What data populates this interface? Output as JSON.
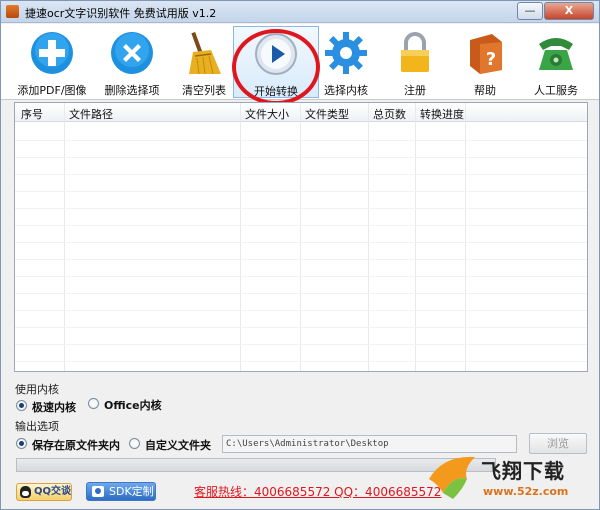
{
  "window": {
    "title": "捷速ocr文字识别软件 免费试用版 v1.2",
    "minimize_glyph": "—",
    "close_glyph": "X"
  },
  "toolbar": {
    "items": [
      {
        "label": "添加PDF/图像",
        "icon": "add-icon"
      },
      {
        "label": "删除选择项",
        "icon": "delete-icon"
      },
      {
        "label": "清空列表",
        "icon": "broom-icon"
      },
      {
        "label": "开始转换",
        "icon": "play-icon"
      },
      {
        "label": "选择内核",
        "icon": "gear-icon"
      },
      {
        "label": "注册",
        "icon": "lock-icon"
      },
      {
        "label": "帮助",
        "icon": "help-book-icon"
      },
      {
        "label": "人工服务",
        "icon": "phone-icon"
      }
    ]
  },
  "file_list": {
    "columns": [
      "序号",
      "文件路径",
      "文件大小",
      "文件类型",
      "总页数",
      "转换进度"
    ],
    "rows": []
  },
  "engine": {
    "section_label": "使用内核",
    "options": [
      {
        "label": "极速内核",
        "checked": true
      },
      {
        "label": "Office内核",
        "checked": false
      }
    ]
  },
  "output": {
    "section_label": "输出选项",
    "options": [
      {
        "label": "保存在原文件夹内",
        "checked": true
      },
      {
        "label": "自定义文件夹",
        "checked": false
      }
    ],
    "path_value": "C:\\Users\\Administrator\\Desktop",
    "browse_label": "浏览"
  },
  "progress": {
    "value": 0
  },
  "bottom": {
    "qq_label": "QQ交谈",
    "sdk_label": "SDK定制",
    "hotline": "客服热线：4006685572 QQ：4006685572"
  },
  "watermark": {
    "text": "飞翔下载",
    "url": "www.52z.com"
  },
  "colors": {
    "accent_red": "#e0161e",
    "toolbar_blue": "#1e90e0",
    "brand_orange": "#d8741c"
  }
}
